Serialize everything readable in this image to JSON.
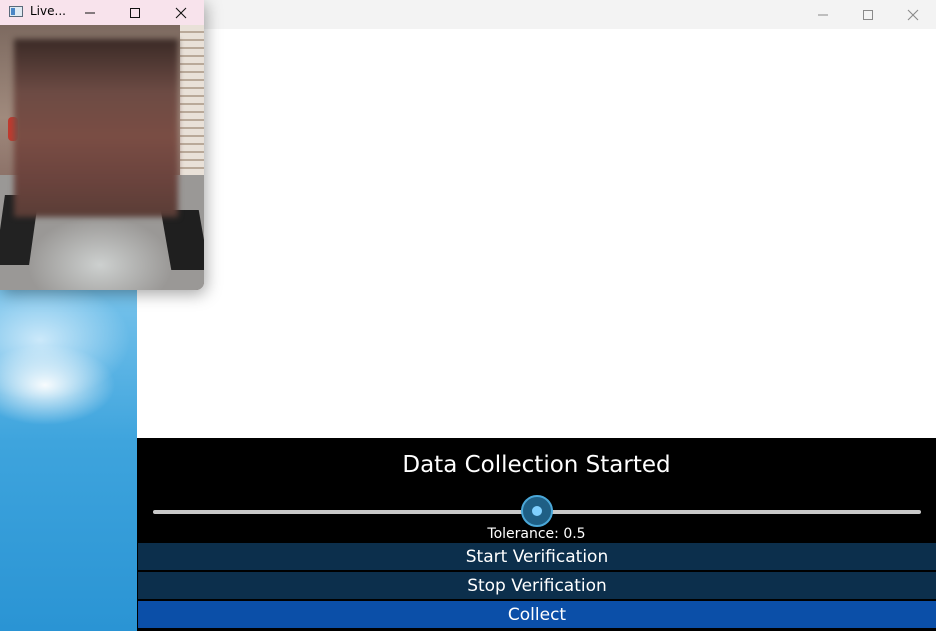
{
  "live_window": {
    "title": "Live...",
    "controls": {
      "minimize": "minimize-icon",
      "maximize": "maximize-icon",
      "close": "close-icon"
    }
  },
  "main_window": {
    "controls": {
      "minimize": "minimize-icon",
      "maximize": "maximize-icon",
      "close": "close-icon"
    },
    "status_text": "Data Collection Started",
    "tolerance": {
      "label": "Tolerance: 0.5",
      "value": 0.5,
      "min": 0,
      "max": 1
    },
    "buttons": {
      "start": "Start Verification",
      "stop": "Stop Verification",
      "collect": "Collect"
    }
  },
  "colors": {
    "panel_bg": "#000000",
    "button_dark": "#0c2f4c",
    "button_accent": "#0b4fa8",
    "slider_accent": "#4aa7d8"
  }
}
